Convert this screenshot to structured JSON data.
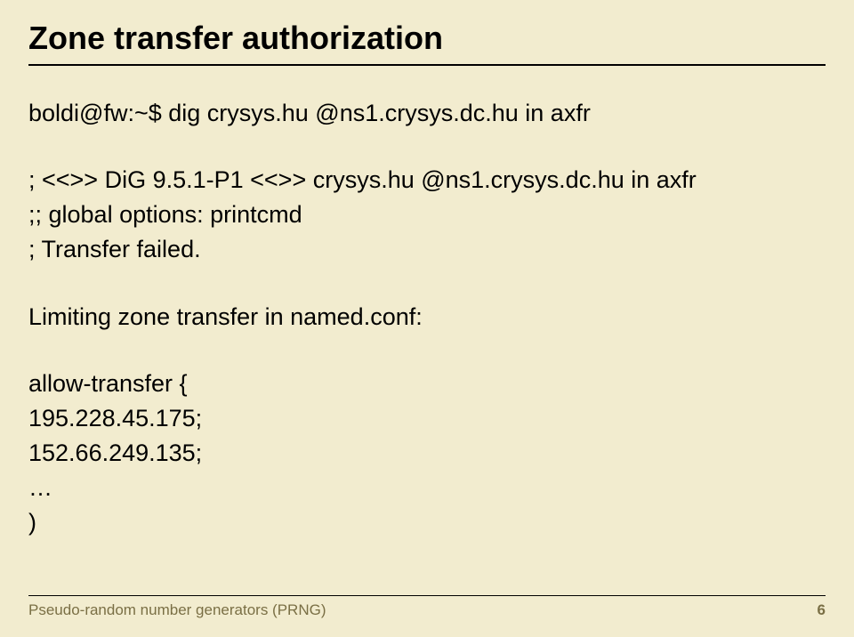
{
  "title": "Zone transfer authorization",
  "cmd": "boldi@fw:~$ dig crysys.hu @ns1.crysys.dc.hu in axfr",
  "out1": "; <<>> DiG 9.5.1-P1 <<>> crysys.hu @ns1.crysys.dc.hu in axfr",
  "out2": ";; global options:  printcmd",
  "out3": "; Transfer failed.",
  "limit_label": "Limiting zone transfer in named.conf:",
  "conf1": "allow-transfer {",
  "conf2": "195.228.45.175;",
  "conf3": "152.66.249.135;",
  "conf4": "…",
  "conf5": ")",
  "footer_text": "Pseudo-random number generators (PRNG)",
  "page_num": "6"
}
